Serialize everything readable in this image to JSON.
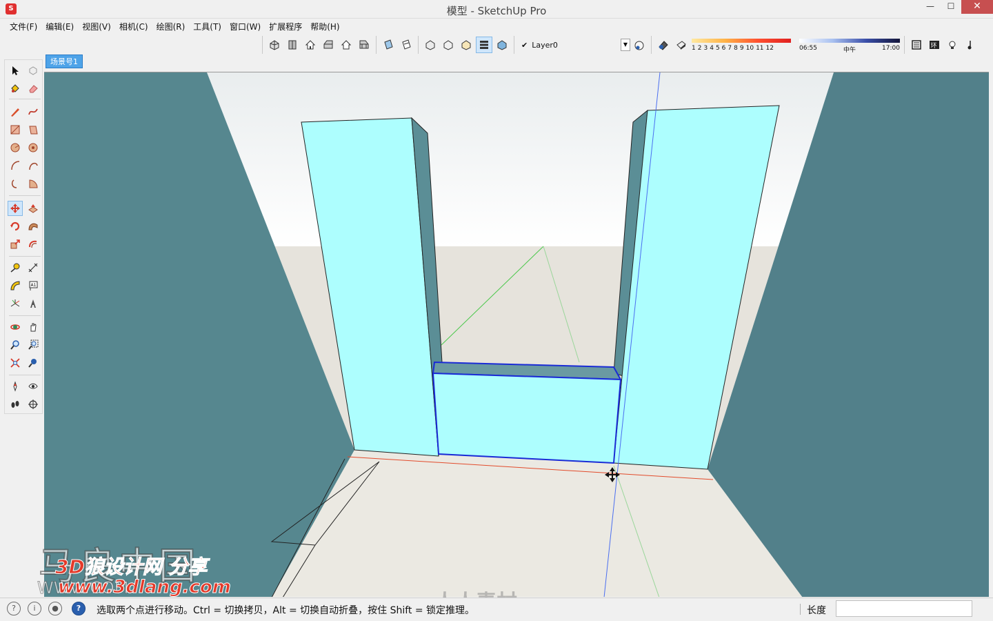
{
  "window": {
    "app_icon": "sketchup-icon",
    "title": "模型 - SketchUp Pro",
    "minimize": "—",
    "maximize": "☐",
    "close": "✕"
  },
  "menu": [
    {
      "label": "文件(F)"
    },
    {
      "label": "编辑(E)"
    },
    {
      "label": "视图(V)"
    },
    {
      "label": "相机(C)"
    },
    {
      "label": "绘图(R)"
    },
    {
      "label": "工具(T)"
    },
    {
      "label": "窗口(W)"
    },
    {
      "label": "扩展程序"
    },
    {
      "label": "帮助(H)"
    }
  ],
  "toolbar": {
    "views": [
      "iso-view-icon",
      "top-view-icon",
      "front-view-icon",
      "right-view-icon",
      "back-view-icon",
      "left-view-icon"
    ],
    "section": [
      "section-plane-icon",
      "section-cut-icon"
    ],
    "styles": [
      "xray-icon",
      "wireframe-icon",
      "hidden-line-icon",
      "shaded-icon",
      "shaded-texture-icon"
    ],
    "active_style_index": 3,
    "layer": {
      "checked": "✔",
      "name": "Layer0"
    },
    "shadows": {
      "months": [
        "1",
        "2",
        "3",
        "4",
        "5",
        "6",
        "7",
        "8",
        "9",
        "10",
        "11",
        "12"
      ],
      "time_start": "06:55",
      "time_mid": "中午",
      "time_end": "17:00"
    },
    "extra": [
      "outliner-icon",
      "environment-icon",
      "light-icon",
      "more-icon"
    ]
  },
  "scene_tab": {
    "label": "场景号1"
  },
  "tools": [
    "select-icon",
    "component-icon",
    "paint-bucket-icon",
    "eraser-icon",
    "pencil-line-icon",
    "freehand-icon",
    "rectangle-icon",
    "rotated-rectangle-icon",
    "circle-icon",
    "polygon-icon",
    "arc-icon",
    "two-point-arc-icon",
    "three-point-arc-icon",
    "pie-icon",
    "move-icon",
    "push-pull-icon",
    "rotate-icon",
    "follow-me-icon",
    "scale-icon",
    "offset-icon",
    "tape-measure-icon",
    "dimension-icon",
    "protractor-icon",
    "text-icon",
    "axes-icon",
    "3d-text-icon",
    "orbit-icon",
    "pan-icon",
    "zoom-icon",
    "zoom-window-icon",
    "zoom-extents-icon",
    "previous-view-icon",
    "position-camera-icon",
    "look-around-icon",
    "walk-icon",
    "section-plane-tool-icon"
  ],
  "active_tool": "move-icon",
  "colors": {
    "wall_side": "#56878f",
    "wall_face": "#adfefe",
    "floor": "#e9e7df",
    "sky": "#ffffff",
    "selection": "#1a2bd6",
    "axis_red": "#e24a2a",
    "axis_green": "#4bc84b",
    "axis_blue": "#4a6ef0"
  },
  "watermark": {
    "site_cn": "马良中国",
    "share": "3D狼设计网 分享",
    "url": "www.3dlang.com",
    "site_en": "WWW.COM",
    "brand": "人人素材"
  },
  "status": {
    "icons": [
      "geo-location-icon",
      "credits-icon",
      "user-icon",
      "help-icon"
    ],
    "message": "选取两个点进行移动。Ctrl = 切换拷贝，Alt = 切换自动折叠，按住 Shift = 锁定推理。",
    "measure_label": "长度",
    "measure_value": ""
  }
}
